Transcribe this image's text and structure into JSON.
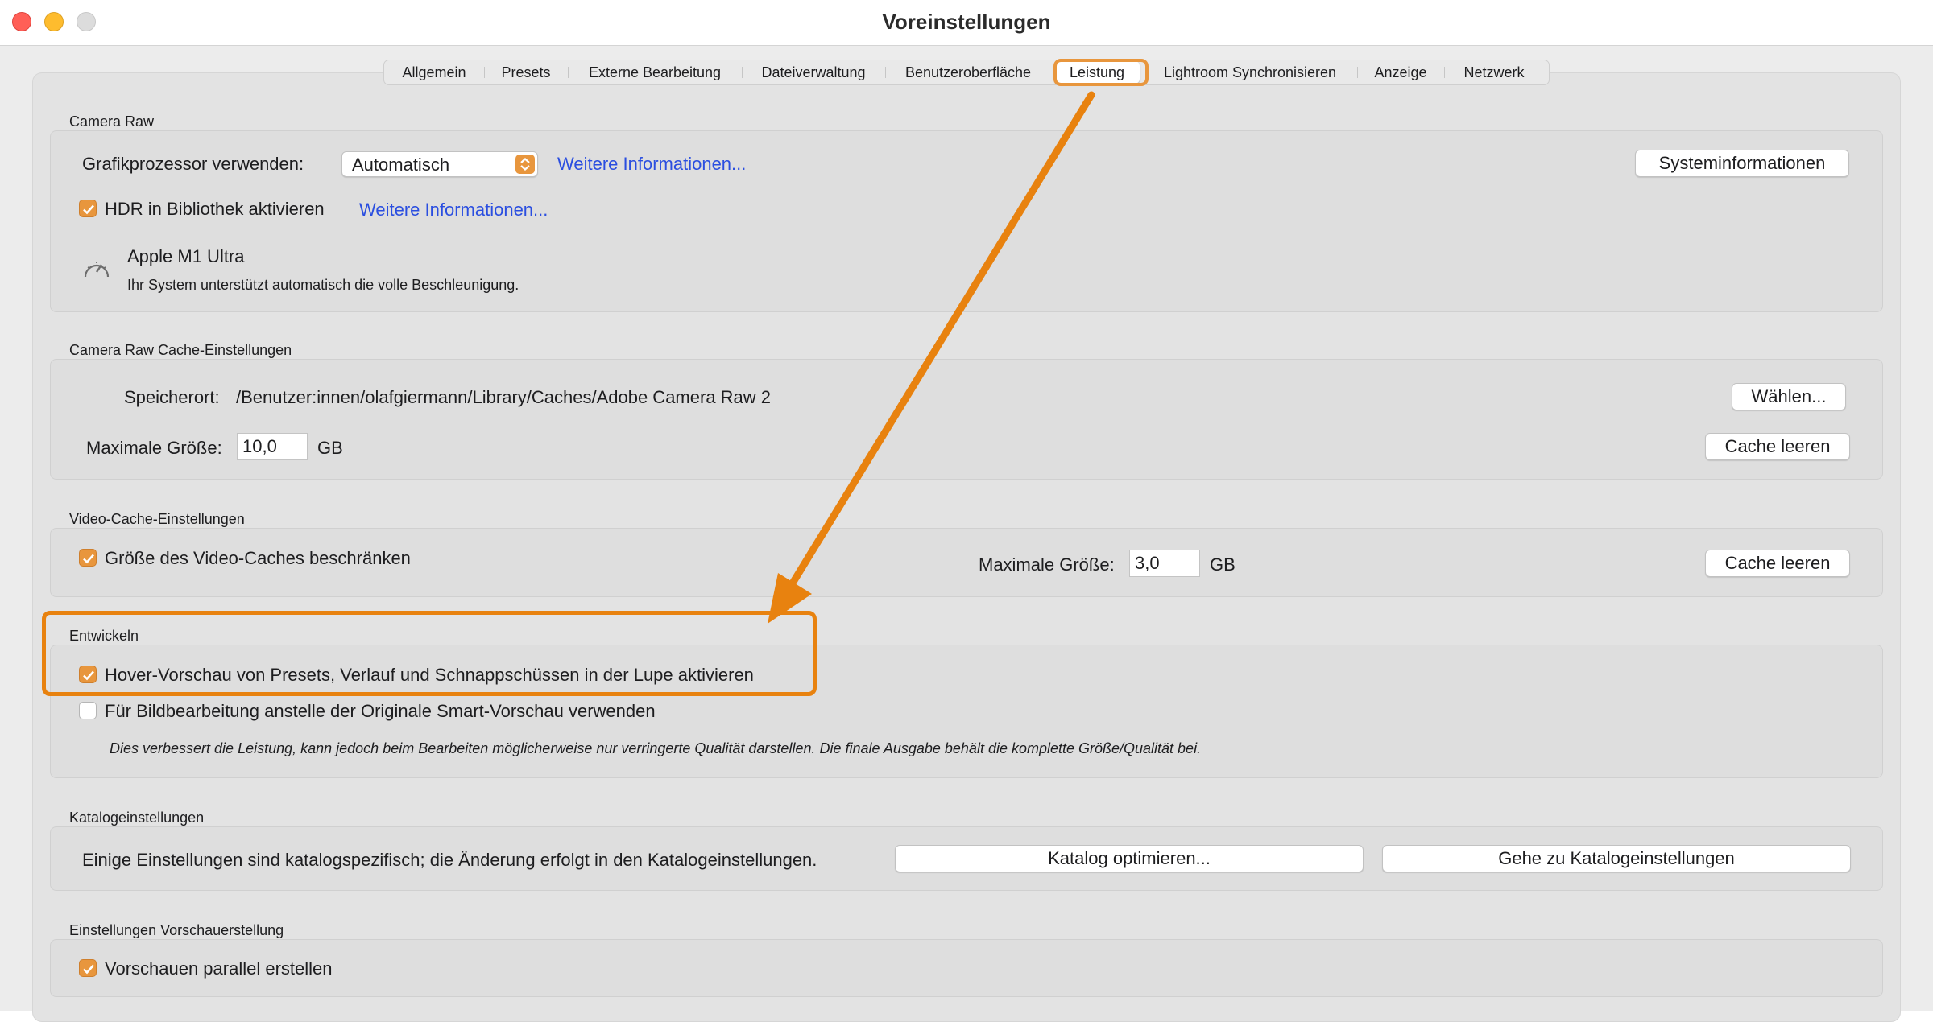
{
  "window": {
    "title": "Voreinstellungen"
  },
  "tabs": [
    {
      "label": "Allgemein",
      "active": false
    },
    {
      "label": "Presets",
      "active": false
    },
    {
      "label": "Externe Bearbeitung",
      "active": false
    },
    {
      "label": "Dateiverwaltung",
      "active": false
    },
    {
      "label": "Benutzeroberfläche",
      "active": false
    },
    {
      "label": "Leistung",
      "active": true
    },
    {
      "label": "Lightroom Synchronisieren",
      "active": false
    },
    {
      "label": "Anzeige",
      "active": false
    },
    {
      "label": "Netzwerk",
      "active": false
    }
  ],
  "camera_raw": {
    "section_title": "Camera Raw",
    "gpu_label": "Grafikprozessor verwenden:",
    "gpu_value": "Automatisch",
    "more_info_1": "Weitere Informationen...",
    "system_info_button": "Systeminformationen",
    "hdr_checked": true,
    "hdr_label": "HDR in Bibliothek aktivieren",
    "more_info_2": "Weitere Informationen...",
    "gpu_name": "Apple M1 Ultra",
    "gpu_status": "Ihr System unterstützt automatisch die volle Beschleunigung."
  },
  "cache": {
    "section_title": "Camera Raw Cache-Einstellungen",
    "location_label": "Speicherort:",
    "location_path": "/Benutzer:innen/olafgiermann/Library/Caches/Adobe Camera Raw 2",
    "choose_button": "Wählen...",
    "max_size_label": "Maximale Größe:",
    "max_size_value": "10,0",
    "max_size_unit": "GB",
    "clear_button": "Cache leeren"
  },
  "video_cache": {
    "section_title": "Video-Cache-Einstellungen",
    "limit_checked": true,
    "limit_label": "Größe des Video-Caches beschränken",
    "max_size_label": "Maximale Größe:",
    "max_size_value": "3,0",
    "max_size_unit": "GB",
    "clear_button": "Cache leeren"
  },
  "develop": {
    "section_title": "Entwickeln",
    "hover_checked": true,
    "hover_label": "Hover-Vorschau von Presets, Verlauf und Schnappschüssen in der Lupe aktivieren",
    "smart_checked": false,
    "smart_label": "Für Bildbearbeitung anstelle der Originale Smart-Vorschau verwenden",
    "smart_note": "Dies verbessert die Leistung, kann jedoch beim Bearbeiten möglicherweise nur verringerte Qualität darstellen. Die finale Ausgabe behält die komplette Größe/Qualität bei."
  },
  "catalog": {
    "section_title": "Katalogeinstellungen",
    "note": "Einige Einstellungen sind katalogspezifisch; die Änderung erfolgt in den Katalogeinstellungen.",
    "optimize_button": "Katalog optimieren...",
    "goto_button": "Gehe zu Katalogeinstellungen"
  },
  "preview": {
    "section_title": "Einstellungen Vorschauerstellung",
    "parallel_checked": true,
    "parallel_label": "Vorschauen parallel erstellen"
  },
  "colors": {
    "accent": "#e8963d",
    "annotation": "#e8820f",
    "link": "#2a4ee0"
  }
}
